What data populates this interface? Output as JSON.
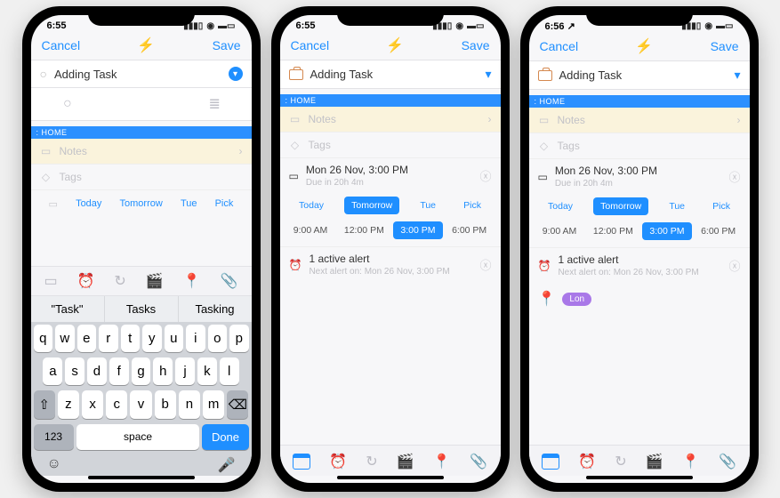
{
  "accent": "#1f8fff",
  "status": {
    "time1": "6:55",
    "time2": "6:55",
    "time3": "6:56 ↗"
  },
  "topbar": {
    "cancel": "Cancel",
    "save": "Save"
  },
  "task": {
    "name": "Adding Task",
    "tag": ": HOME"
  },
  "placeholders": {
    "notes": "Notes",
    "tags": "Tags"
  },
  "dayChips": [
    "Today",
    "Tomorrow",
    "Tue",
    "Pick"
  ],
  "timeChips": [
    "9:00 AM",
    "12:00 PM",
    "3:00 PM",
    "6:00 PM"
  ],
  "activeDay": "Tomorrow",
  "activeTime": "3:00 PM",
  "date": {
    "label": "Mon 26 Nov, 3:00 PM",
    "sub": "Due in 20h 4m"
  },
  "alert": {
    "label": "1 active alert",
    "sub": "Next alert on: Mon 26 Nov, 3:00 PM"
  },
  "location": {
    "pill": "Lon"
  },
  "keyboard": {
    "suggestions": [
      "\"Task\"",
      "Tasks",
      "Tasking"
    ],
    "row1": [
      "q",
      "w",
      "e",
      "r",
      "t",
      "y",
      "u",
      "i",
      "o",
      "p"
    ],
    "row2": [
      "a",
      "s",
      "d",
      "f",
      "g",
      "h",
      "j",
      "k",
      "l"
    ],
    "row3": [
      "⇧",
      "z",
      "x",
      "c",
      "v",
      "b",
      "n",
      "m",
      "⌫"
    ],
    "numKey": "123",
    "space": "space",
    "done": "Done"
  },
  "icons": {
    "bolt": "⚡",
    "chevDown": "▾",
    "chevRight": "›",
    "close": "ⓧ",
    "calendar": "▭",
    "alarm": "⏰",
    "repeat": "↻",
    "clapper": "🎬",
    "pin": "📍",
    "clip": "📎",
    "circle": "○",
    "list": "≣",
    "notes": "▭",
    "tag": "◇",
    "clock": "◴",
    "emoji": "☺",
    "mic": "🎤"
  }
}
